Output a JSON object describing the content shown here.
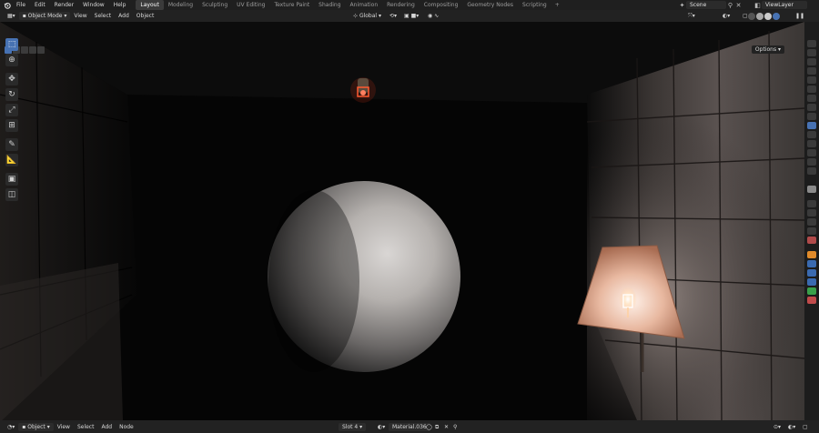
{
  "topbar": {
    "menus": [
      "File",
      "Edit",
      "Render",
      "Window",
      "Help"
    ],
    "workspaces": [
      "Layout",
      "Modeling",
      "Sculpting",
      "UV Editing",
      "Texture Paint",
      "Shading",
      "Animation",
      "Rendering",
      "Compositing",
      "Geometry Nodes",
      "Scripting"
    ],
    "active_workspace": "Layout",
    "add_tab": "+",
    "scene": "Scene",
    "view_layer": "ViewLayer"
  },
  "viewport_header": {
    "mode": "Object Mode",
    "menus": [
      "View",
      "Select",
      "Add",
      "Object"
    ],
    "orientation": "Global",
    "options": "Options"
  },
  "bottom_bar": {
    "mode": "Object",
    "menus": [
      "View",
      "Select",
      "Add",
      "Node"
    ],
    "slot": "Slot 4",
    "material": "Material.036"
  },
  "colors": {
    "accent": "#4772b3",
    "lamp_glow": "#ff3a1a"
  },
  "icons": {
    "toolbar": [
      "select-box-icon",
      "cursor-icon",
      "move-icon",
      "rotate-icon",
      "scale-icon",
      "transform-icon",
      "annotate-icon",
      "measure-icon",
      "add-cube-icon",
      "add-object-icon"
    ]
  }
}
